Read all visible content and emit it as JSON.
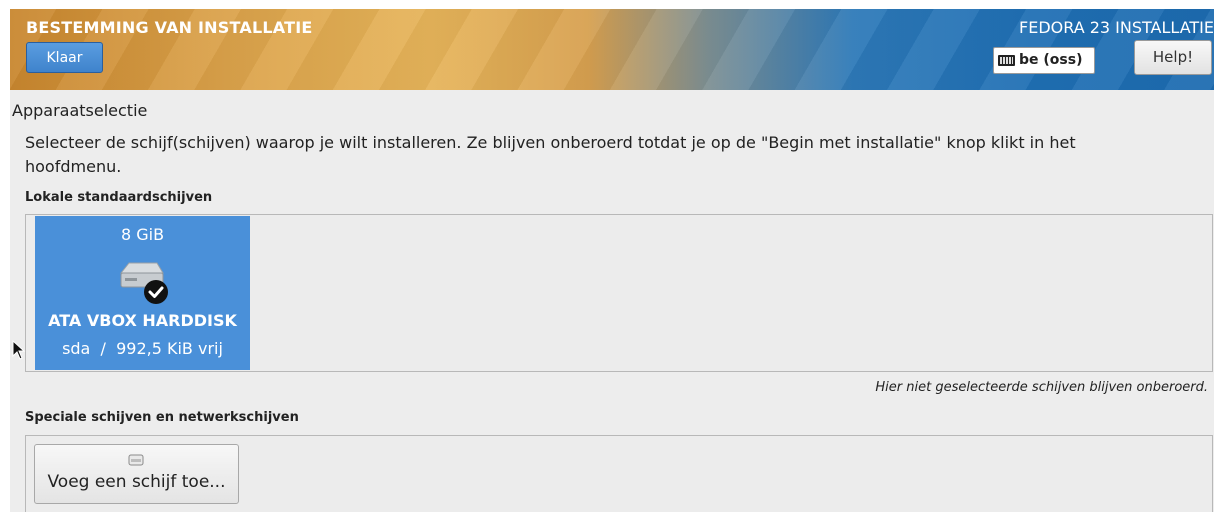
{
  "header": {
    "spoke_title": "BESTEMMING VAN INSTALLATIE",
    "done_label": "Klaar",
    "product_title": "FEDORA 23 INSTALLATIE",
    "keyboard_layout": "be (oss)",
    "help_label": "Help!",
    "icons": {
      "keyboard": "keyboard-icon"
    }
  },
  "device_selection": {
    "title": "Apparaatselectie",
    "description": "Selecteer de schijf(schijven) waarop je wilt installeren.  Ze blijven onberoerd totdat je op de \"Begin met installatie\" knop klikt in het hoofdmenu.",
    "local_disks_label": "Lokale standaardschijven",
    "disks": [
      {
        "size": "8 GiB",
        "name": "ATA VBOX HARDDISK",
        "device": "sda",
        "separator": "/",
        "free": "992,5 KiB vrij",
        "selected": true,
        "icon": "harddisk-checked-icon"
      }
    ],
    "unselected_hint": "Hier niet geselecteerde schijven blijven onberoerd.",
    "special_disks_label": "Speciale schijven en netwerkschijven",
    "add_disk_label": "Voeg een schijf toe...",
    "add_disk_icon": "disk-add-icon"
  },
  "colors": {
    "selected_tile": "#4a90d9",
    "done_button": "#4a8fd6",
    "background": "#ededed"
  }
}
